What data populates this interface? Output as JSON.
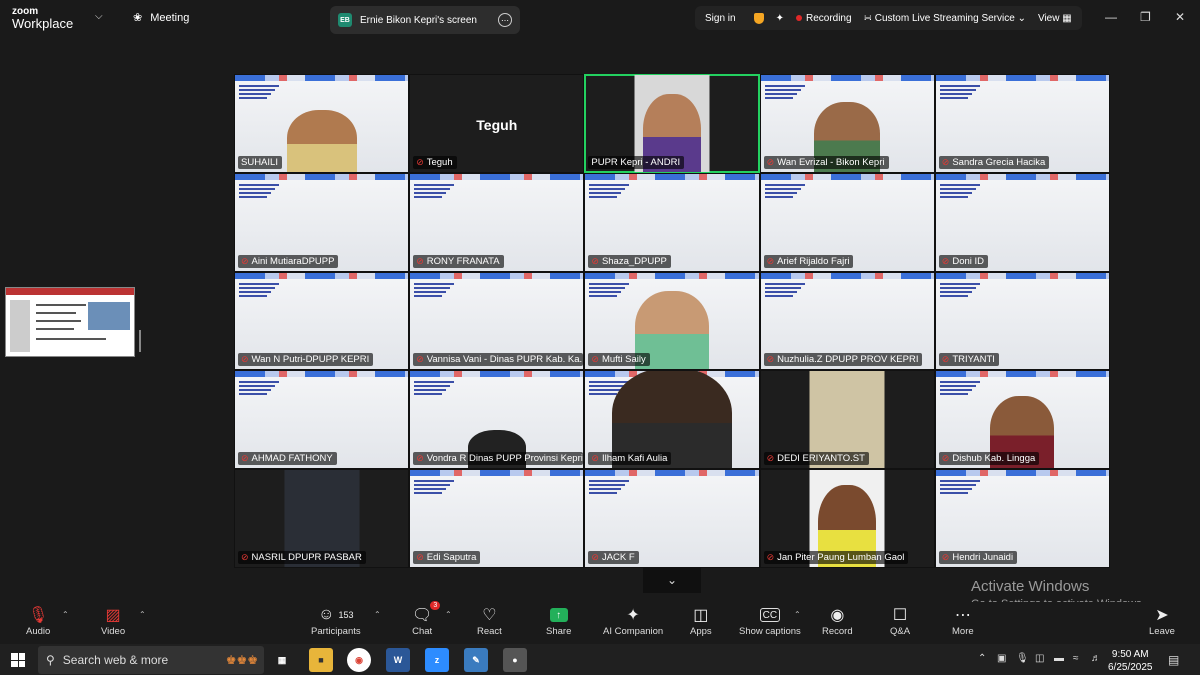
{
  "app": {
    "logo_line1": "zoom",
    "logo_line2": "Workplace",
    "meeting_label": "Meeting",
    "screen_tab_badge": "EB",
    "screen_tab_label": "Ernie Bikon Kepri's screen",
    "sign_in": "Sign in",
    "recording": "Recording",
    "streaming": "Custom Live Streaming Service",
    "view": "View"
  },
  "participants": [
    {
      "name": "SUHAILI",
      "type": "video"
    },
    {
      "name": "Teguh",
      "type": "name"
    },
    {
      "name": "PUPR Kepri - ANDRI",
      "type": "video"
    },
    {
      "name": "Wan Evrizal - Bikon Kepri",
      "type": "video"
    },
    {
      "name": "Sandra Grecia Hacika",
      "type": "slide"
    },
    {
      "name": "Aini MutiaraDPUPP",
      "type": "slide"
    },
    {
      "name": "RONY FRANATA",
      "type": "slide"
    },
    {
      "name": "Shaza_DPUPP",
      "type": "slide"
    },
    {
      "name": "Arief Rijaldo Fajri",
      "type": "slide"
    },
    {
      "name": "Doni ID",
      "type": "slide"
    },
    {
      "name": "Wan N Putri-DPUPP KEPRI",
      "type": "slide"
    },
    {
      "name": "Vannisa Vani - Dinas PUPR Kab. Ka...",
      "type": "slide"
    },
    {
      "name": "Mufti Saily",
      "type": "video"
    },
    {
      "name": "Nuzhulia.Z DPUPP PROV KEPRI",
      "type": "slide"
    },
    {
      "name": "TRIYANTI",
      "type": "slide"
    },
    {
      "name": "AHMAD FATHONY",
      "type": "slide"
    },
    {
      "name": "Vondra R Dinas PUPP Provinsi Kepri",
      "type": "video"
    },
    {
      "name": "Ilham Kafi Aulia",
      "type": "video"
    },
    {
      "name": "DEDI ERIYANTO.ST",
      "type": "video"
    },
    {
      "name": "Dishub Kab. Lingga",
      "type": "video"
    },
    {
      "name": "NASRIL DPUPR PASBAR",
      "type": "video"
    },
    {
      "name": "Edi Saputra",
      "type": "slide"
    },
    {
      "name": "JACK F",
      "type": "slide"
    },
    {
      "name": "Jan Piter Paung Lumban Gaol",
      "type": "video"
    },
    {
      "name": "Hendri Junaidi",
      "type": "slide"
    }
  ],
  "watermark": {
    "line1": "Activate Windows",
    "line2": "Go to Settings to activate Windows."
  },
  "toolbar": {
    "audio": "Audio",
    "video": "Video",
    "participants": "Participants",
    "participants_count": "153",
    "chat": "Chat",
    "chat_badge": "3",
    "react": "React",
    "share": "Share",
    "ai_companion": "AI Companion",
    "apps": "Apps",
    "show_captions": "Show captions",
    "record": "Record",
    "qa": "Q&A",
    "more": "More",
    "leave": "Leave"
  },
  "taskbar": {
    "search_placeholder": "Search web & more",
    "time": "9:50 AM",
    "date": "6/25/2025"
  },
  "colors": {
    "accent_green": "#23d160",
    "mute_red": "#e53935",
    "share_green": "#23b05a"
  }
}
